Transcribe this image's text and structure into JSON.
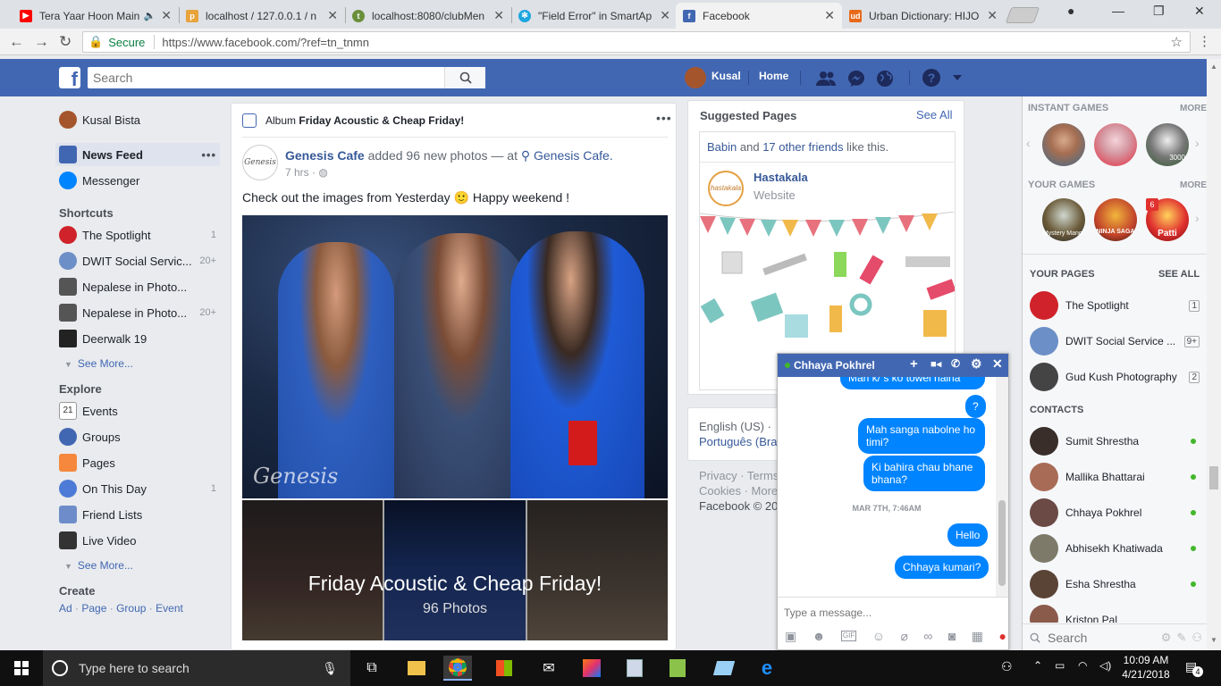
{
  "browser": {
    "tabs": [
      {
        "title": "Tera Yaar Hoon Main",
        "favicon_color": "#ff0000"
      },
      {
        "title": "localhost / 127.0.0.1 / n",
        "favicon_color": "#e8a33b"
      },
      {
        "title": "localhost:8080/clubMen",
        "favicon_color": "#6a8f3a"
      },
      {
        "title": "\"Field Error\" in SmartAp",
        "favicon_color": "#1ca6e0"
      },
      {
        "title": "Facebook",
        "favicon_color": "#4267b2"
      },
      {
        "title": "Urban Dictionary: HIJO",
        "favicon_color": "#e86a19"
      }
    ],
    "secure_label": "Secure",
    "url": "https://www.facebook.com/?ref=tn_tnmn"
  },
  "fb_top": {
    "search_placeholder": "Search",
    "user_name": "Kusal",
    "home_label": "Home"
  },
  "left_nav": {
    "profile_name": "Kusal Bista",
    "news_feed": "News Feed",
    "messenger": "Messenger",
    "shortcuts_title": "Shortcuts",
    "shortcuts": [
      {
        "label": "The Spotlight",
        "count": "1"
      },
      {
        "label": "DWIT Social Servic...",
        "count": "20+"
      },
      {
        "label": "Nepalese in Photo...",
        "count": ""
      },
      {
        "label": "Nepalese in Photo...",
        "count": "20+"
      },
      {
        "label": "Deerwalk 19",
        "count": ""
      }
    ],
    "see_more": "See More...",
    "explore_title": "Explore",
    "explore": [
      {
        "label": "Events",
        "count": ""
      },
      {
        "label": "Groups",
        "count": ""
      },
      {
        "label": "Pages",
        "count": ""
      },
      {
        "label": "On This Day",
        "count": "1"
      },
      {
        "label": "Friend Lists",
        "count": ""
      },
      {
        "label": "Live Video",
        "count": ""
      }
    ],
    "create_title": "Create",
    "create_links": [
      "Ad",
      "Page",
      "Group",
      "Event"
    ]
  },
  "post": {
    "album_prefix": "Album",
    "album_title": "Friday Acoustic & Cheap Friday!",
    "page_name": "Genesis Cafe",
    "action": "added 96 new photos — at",
    "location": "Genesis Cafe.",
    "time": "7 hrs",
    "text": "Check out the images from Yesterday 🙂 Happy weekend !",
    "overlay_title": "Friday Acoustic & Cheap Friday!",
    "overlay_count": "96 Photos",
    "watermark": "Genesis"
  },
  "suggested": {
    "title": "Suggested Pages",
    "see_all": "See All",
    "friend_name": "Babin",
    "and_text": "and",
    "other_friends": "17 other friends",
    "like_text": "like this.",
    "page_name": "Hastakala",
    "page_type": "Website",
    "logo_text": "hastakala"
  },
  "lang": {
    "line1": "English (US) · ",
    "line2": "Português (Bra"
  },
  "footer": {
    "line1": "Privacy · Terms",
    "line2": "Cookies · More",
    "line3": "Facebook © 20"
  },
  "right": {
    "instant_games": "INSTANT GAMES",
    "your_games": "YOUR GAMES",
    "more": "MORE",
    "your_pages": "YOUR PAGES",
    "see_all": "SEE ALL",
    "pages": [
      {
        "label": "The Spotlight",
        "count": "1"
      },
      {
        "label": "DWIT Social Service ...",
        "count": "9+"
      },
      {
        "label": "Gud Kush Photography",
        "count": "2"
      }
    ],
    "contacts_title": "CONTACTS",
    "contacts": [
      "Sumit Shrestha",
      "Mallika Bhattarai",
      "Chhaya Pokhrel",
      "Abhisekh Khatiwada",
      "Esha Shrestha",
      "Kriston Pal"
    ],
    "search_placeholder": "Search",
    "game_badge": "6",
    "game_label_patti": "Patti",
    "game_label_ninja": "NINJA SAGA",
    "game_label_mystery": "Mystery Manor",
    "game_label_score": "3000"
  },
  "chat": {
    "name": "Chhaya Pokhrel",
    "partial_msg": "Mah k/ s ko towel haina",
    "messages": [
      {
        "text": "?"
      },
      {
        "text": "Mah sanga nabolne ho timi?"
      },
      {
        "text": "Ki bahira chau  bhane bhana?"
      }
    ],
    "date_divider": "MAR 7TH, 7:46AM",
    "messages2": [
      {
        "text": "Hello"
      },
      {
        "text": "Chhaya kumari?"
      }
    ],
    "input_placeholder": "Type a message..."
  },
  "taskbar": {
    "search_placeholder": "Type here to search",
    "time": "10:09 AM",
    "date": "4/21/2018",
    "notif_count": "4"
  }
}
